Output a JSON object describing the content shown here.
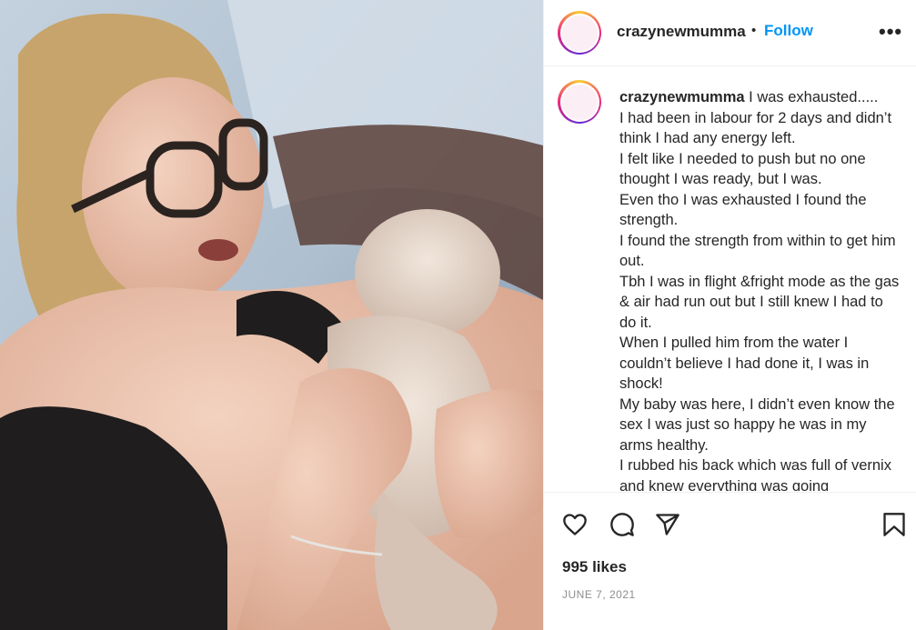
{
  "post": {
    "username": "crazynewmumma",
    "separator": "•",
    "follow_label": "Follow",
    "more_label": "•••",
    "avatar_text": "Ti... crazynewmumma"
  },
  "caption": {
    "username": "crazynewmumma",
    "lines": [
      "I was exhausted.....",
      "I had been in labour for 2 days and didn’t think I had any energy left.",
      "I felt like I needed to push but no one thought I was ready, but I was.",
      "Even tho I was exhausted I found the strength.",
      "I found the strength from within to get him out.",
      "Tbh I was in flight &fright mode as the gas & air had run out but I still knew I had to do it.",
      "When I pulled him from the water I couldn’t believe I had done it, I was in shock!",
      "My baby was here, I didn’t even know the sex I was just so happy he was in my arms healthy.",
      "I rubbed his back which was full of vernix and knew everything was going"
    ]
  },
  "actions": {
    "like_icon": "heart-icon",
    "comment_icon": "comment-icon",
    "share_icon": "share-icon",
    "save_icon": "bookmark-icon"
  },
  "stats": {
    "likes": "995 likes",
    "date": "JUNE 7, 2021"
  },
  "colors": {
    "accent": "#0095f6",
    "text": "#262626",
    "muted": "#8e8e8e",
    "border": "#efefef"
  }
}
